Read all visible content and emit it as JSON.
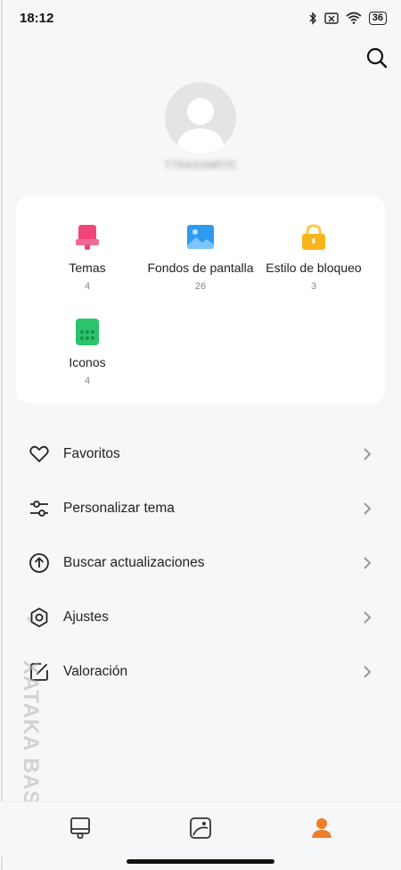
{
  "status_bar": {
    "time": "18:12",
    "battery": "36",
    "icons": [
      "bluetooth-icon",
      "no-sim-icon",
      "wifi-icon",
      "battery-icon"
    ]
  },
  "header": {
    "search_icon": "search-icon"
  },
  "profile": {
    "username": "TTRASSMRTE"
  },
  "categories": [
    {
      "label": "Temas",
      "count": "4",
      "icon": "theme-icon",
      "color": "#f0457a"
    },
    {
      "label": "Fondos de pantalla",
      "count": "26",
      "icon": "wallpaper-icon",
      "color": "#2d9bf0"
    },
    {
      "label": "Estilo de bloqueo",
      "count": "3",
      "icon": "lock-style-icon",
      "color": "#f8b51a"
    },
    {
      "label": "Iconos",
      "count": "4",
      "icon": "icons-icon",
      "color": "#2bc46d"
    }
  ],
  "menu": [
    {
      "label": "Favoritos",
      "icon": "heart-icon"
    },
    {
      "label": "Personalizar tema",
      "icon": "sliders-icon"
    },
    {
      "label": "Buscar actualizaciones",
      "icon": "update-icon"
    },
    {
      "label": "Ajustes",
      "icon": "settings-icon"
    },
    {
      "label": "Valoración",
      "icon": "rating-icon"
    }
  ],
  "watermark": {
    "text": "XATAKA BASICS"
  },
  "bottom_nav": [
    {
      "icon": "themes-tab-icon",
      "active": false
    },
    {
      "icon": "wallpapers-tab-icon",
      "active": false
    },
    {
      "icon": "profile-tab-icon",
      "active": true,
      "color": "#f07d2a"
    }
  ]
}
